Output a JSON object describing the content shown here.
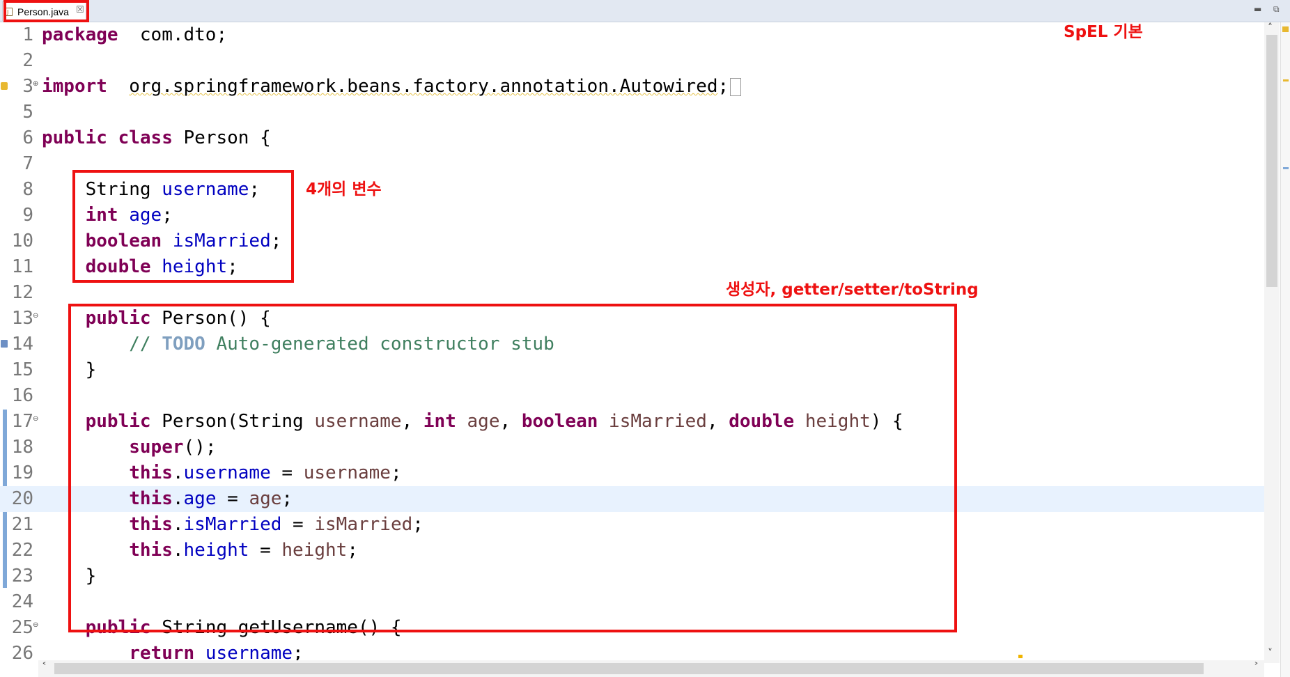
{
  "tab": {
    "label": "Person.java",
    "close_glyph": "☒"
  },
  "window": {
    "minimize_glyph": "▬",
    "restore_glyph": "⧉"
  },
  "annotations": {
    "title": "SpEL 기본",
    "fields_note": "4개의 변수",
    "methods_note": "생성자, getter/setter/toString"
  },
  "editor": {
    "current_line": 20,
    "lines": [
      {
        "n": "1",
        "tokens": [
          [
            "kw",
            "package"
          ],
          [
            "",
            "  com.dto;"
          ]
        ]
      },
      {
        "n": "2",
        "tokens": []
      },
      {
        "n": "3",
        "fold": "⊕",
        "marker": "warning",
        "tokens": [
          [
            "kw",
            "import"
          ],
          [
            "",
            "  "
          ],
          [
            "warn",
            "org.springframework.beans.factory.annotation.Autowired"
          ],
          [
            "",
            ";"
          ]
        ]
      },
      {
        "n": "5",
        "tokens": []
      },
      {
        "n": "6",
        "tokens": [
          [
            "kw",
            "public"
          ],
          [
            "",
            " "
          ],
          [
            "kw",
            "class"
          ],
          [
            "",
            " Person {"
          ]
        ]
      },
      {
        "n": "7",
        "tokens": []
      },
      {
        "n": "8",
        "tokens": [
          [
            "",
            "    String "
          ],
          [
            "fld",
            "username"
          ],
          [
            "",
            ";"
          ]
        ]
      },
      {
        "n": "9",
        "tokens": [
          [
            "",
            "    "
          ],
          [
            "kw",
            "int"
          ],
          [
            "",
            " "
          ],
          [
            "fld",
            "age"
          ],
          [
            "",
            ";"
          ]
        ]
      },
      {
        "n": "10",
        "tokens": [
          [
            "",
            "    "
          ],
          [
            "kw",
            "boolean"
          ],
          [
            "",
            " "
          ],
          [
            "fld",
            "isMarried"
          ],
          [
            "",
            ";"
          ]
        ]
      },
      {
        "n": "11",
        "tokens": [
          [
            "",
            "    "
          ],
          [
            "kw",
            "double"
          ],
          [
            "",
            " "
          ],
          [
            "fld",
            "height"
          ],
          [
            "",
            ";"
          ]
        ]
      },
      {
        "n": "12",
        "tokens": []
      },
      {
        "n": "13",
        "fold": "⊖",
        "tokens": [
          [
            "",
            "    "
          ],
          [
            "kw",
            "public"
          ],
          [
            "",
            " Person() {"
          ]
        ]
      },
      {
        "n": "14",
        "marker": "task",
        "tokens": [
          [
            "cmt",
            "        // "
          ],
          [
            "todo",
            "TODO"
          ],
          [
            "cmt",
            " Auto-generated constructor stub"
          ]
        ]
      },
      {
        "n": "15",
        "tokens": [
          [
            "",
            "    }"
          ]
        ]
      },
      {
        "n": "16",
        "tokens": []
      },
      {
        "n": "17",
        "fold": "⊖",
        "tokens": [
          [
            "",
            "    "
          ],
          [
            "kw",
            "public"
          ],
          [
            "",
            " Person(String "
          ],
          [
            "prm",
            "username"
          ],
          [
            "",
            ", "
          ],
          [
            "kw",
            "int"
          ],
          [
            "",
            " "
          ],
          [
            "prm",
            "age"
          ],
          [
            "",
            ", "
          ],
          [
            "kw",
            "boolean"
          ],
          [
            "",
            " "
          ],
          [
            "prm",
            "isMarried"
          ],
          [
            "",
            ", "
          ],
          [
            "kw",
            "double"
          ],
          [
            "",
            " "
          ],
          [
            "prm",
            "height"
          ],
          [
            "",
            ") {"
          ]
        ]
      },
      {
        "n": "18",
        "tokens": [
          [
            "",
            "        "
          ],
          [
            "kw",
            "super"
          ],
          [
            "",
            "();"
          ]
        ]
      },
      {
        "n": "19",
        "tokens": [
          [
            "",
            "        "
          ],
          [
            "kw",
            "this"
          ],
          [
            "",
            "."
          ],
          [
            "fld",
            "username"
          ],
          [
            "",
            " = "
          ],
          [
            "prm",
            "username"
          ],
          [
            "",
            ";"
          ]
        ]
      },
      {
        "n": "20",
        "tokens": [
          [
            "",
            "        "
          ],
          [
            "kw",
            "this"
          ],
          [
            "",
            "."
          ],
          [
            "fld",
            "age"
          ],
          [
            "",
            " = "
          ],
          [
            "prm",
            "age"
          ],
          [
            "",
            ";"
          ]
        ]
      },
      {
        "n": "21",
        "tokens": [
          [
            "",
            "        "
          ],
          [
            "kw",
            "this"
          ],
          [
            "",
            "."
          ],
          [
            "fld",
            "isMarried"
          ],
          [
            "",
            " = "
          ],
          [
            "prm",
            "isMarried"
          ],
          [
            "",
            ";"
          ]
        ]
      },
      {
        "n": "22",
        "tokens": [
          [
            "",
            "        "
          ],
          [
            "kw",
            "this"
          ],
          [
            "",
            "."
          ],
          [
            "fld",
            "height"
          ],
          [
            "",
            " = "
          ],
          [
            "prm",
            "height"
          ],
          [
            "",
            ";"
          ]
        ]
      },
      {
        "n": "23",
        "tokens": [
          [
            "",
            "    }"
          ]
        ]
      },
      {
        "n": "24",
        "tokens": []
      },
      {
        "n": "25",
        "fold": "⊖",
        "tokens": [
          [
            "",
            "    "
          ],
          [
            "kw",
            "public"
          ],
          [
            "",
            " String getUsername() {"
          ]
        ]
      },
      {
        "n": "26",
        "tokens": [
          [
            "",
            "        "
          ],
          [
            "kw",
            "return"
          ],
          [
            "",
            " "
          ],
          [
            "fld",
            "username"
          ],
          [
            "",
            ";"
          ]
        ]
      }
    ]
  }
}
